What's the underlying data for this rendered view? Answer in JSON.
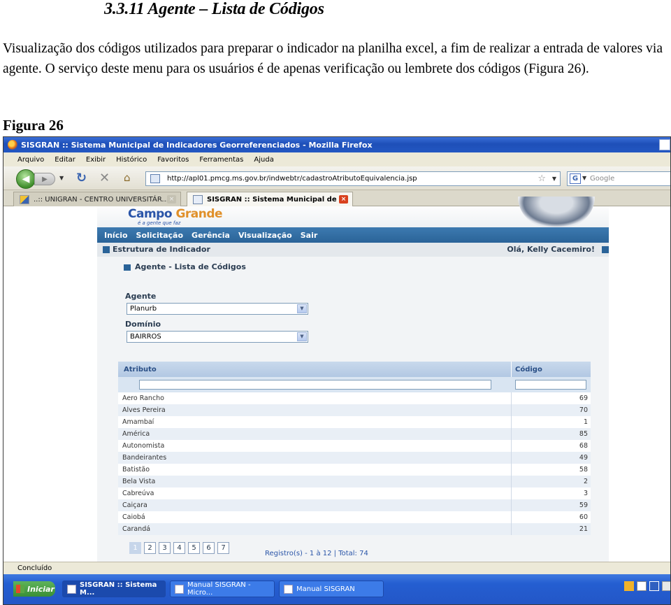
{
  "document": {
    "heading": "3.3.11 Agente – Lista de Códigos",
    "paragraph": "Visualização dos códigos utilizados para preparar o indicador na planilha excel, a fim de realizar a entrada de valores via agente. O serviço deste menu para os usuários é de apenas verificação ou lembrete dos códigos (Figura 26).",
    "figure_label": "Figura 26"
  },
  "browser": {
    "window_title": "SISGRAN :: Sistema Municipal de Indicadores Georreferenciados - Mozilla Firefox",
    "menu": [
      "Arquivo",
      "Editar",
      "Exibir",
      "Histórico",
      "Favoritos",
      "Ferramentas",
      "Ajuda"
    ],
    "url": "http://apl01.pmcg.ms.gov.br/indwebtr/cadastroAtributoEquivalencia.jsp",
    "search_placeholder": "Google",
    "search_engine_icon": "G",
    "tabs": [
      {
        "label": "..:: UNIGRAN - CENTRO UNIVERSITÁR...",
        "close": "×"
      },
      {
        "label": "SISGRAN :: Sistema Municipal de ...",
        "close": "×"
      }
    ],
    "status": "Concluído"
  },
  "site": {
    "logo_main": "Campo",
    "logo_accent": "Grande",
    "logo_tagline": "é a gente que faz",
    "nav": [
      "Início",
      "Solicitação",
      "Gerência",
      "Visualização",
      "Sair"
    ],
    "breadcrumb": "Estrutura de Indicador",
    "greeting": "Olá, Kelly Cacemiro!",
    "section_title": "Agente - Lista de Códigos",
    "agente_label": "Agente",
    "agente_value": "Planurb",
    "dominio_label": "Domínio",
    "dominio_value": "BAIRROS",
    "table": {
      "col_attr": "Atributo",
      "col_code": "Código",
      "rows": [
        {
          "attr": "Aero Rancho",
          "code": "69"
        },
        {
          "attr": "Alves Pereira",
          "code": "70"
        },
        {
          "attr": "Amambaí",
          "code": "1"
        },
        {
          "attr": "América",
          "code": "85"
        },
        {
          "attr": "Autonomista",
          "code": "68"
        },
        {
          "attr": "Bandeirantes",
          "code": "49"
        },
        {
          "attr": "Batistão",
          "code": "58"
        },
        {
          "attr": "Bela Vista",
          "code": "2"
        },
        {
          "attr": "Cabreúva",
          "code": "3"
        },
        {
          "attr": "Caiçara",
          "code": "59"
        },
        {
          "attr": "Caiobá",
          "code": "60"
        },
        {
          "attr": "Carandá",
          "code": "21"
        }
      ]
    },
    "pager": {
      "pages": [
        "1",
        "2",
        "3",
        "4",
        "5",
        "6",
        "7"
      ],
      "current": "1",
      "info": "Registro(s) - 1 à 12 | Total: 74"
    }
  },
  "taskbar": {
    "start": "Iniciar",
    "tasks": [
      "SISGRAN :: Sistema M...",
      "Manual SISGRAN - Micro...",
      "Manual SISGRAN"
    ]
  },
  "colors": {
    "nav_blue": "#2a6398",
    "header_blue": "#c9d9ec",
    "accent_orange": "#e0902a"
  }
}
